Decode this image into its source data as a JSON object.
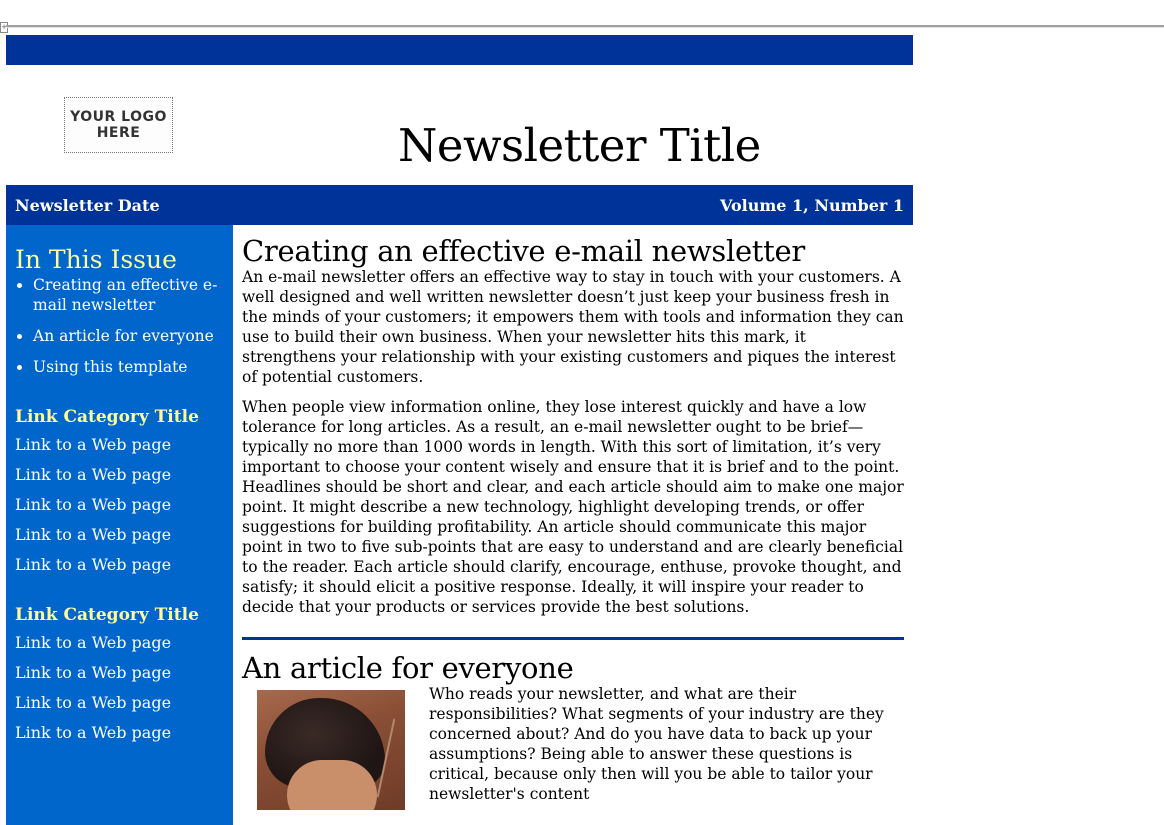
{
  "header": {
    "logo_text": "YOUR LOGO HERE",
    "title": "Newsletter Title",
    "date": "Newsletter Date",
    "volume": "Volume 1, Number 1"
  },
  "sidebar": {
    "issue_heading": "In This Issue",
    "issue_items": [
      "Creating an effective e-mail newsletter",
      "An article for everyone",
      "Using this template"
    ],
    "categories": [
      {
        "title": "Link Category Title",
        "links": [
          "Link to a Web page",
          "Link to a Web page",
          "Link to a Web page",
          "Link to a Web page",
          "Link to a Web page"
        ]
      },
      {
        "title": "Link Category Title",
        "links": [
          "Link to a Web page",
          "Link to a Web page",
          "Link to a Web page",
          "Link to a Web page"
        ]
      }
    ]
  },
  "colors": {
    "dark_blue": "#003399",
    "sidebar_blue": "#0066cc",
    "heading_yellow": "#ffff99"
  },
  "articles": [
    {
      "title": "Creating an effective e-mail newsletter",
      "paragraphs": [
        "An e-mail newsletter offers an effective way to stay in touch with your customers. A well designed and well written newsletter doesn’t just keep your business fresh in the minds of your customers; it empowers them with tools and information they can use to build their own business. When your newsletter hits this mark, it strengthens your relationship with your existing customers and piques the interest of potential customers.",
        "When people view information online, they lose interest quickly and have a low tolerance for long articles. As a result, an e-mail newsletter ought to be brief—typically no more than 1000 words in length. With this sort of limitation, it’s very important to choose your content wisely and ensure that it is brief and to the point. Headlines should be short and clear, and each article should aim to make one major point. It might describe a new technology, highlight developing trends, or offer suggestions for building profitability. An article should communicate this major point in two to five sub-points that are easy to understand and are clearly beneficial to the reader. Each article should clarify, encourage, enthuse, provoke thought, and satisfy; it should elicit a positive response. Ideally, it will inspire your reader to decide that your products or services provide the best solutions."
      ]
    },
    {
      "title": "An article for everyone",
      "paragraphs": [
        "Who reads your newsletter, and what are their responsibilities? What segments of your industry are they concerned about? And do you have data to back up your assumptions? Being able to answer these questions is critical, because only then will you be able to tailor your newsletter's content"
      ]
    }
  ]
}
